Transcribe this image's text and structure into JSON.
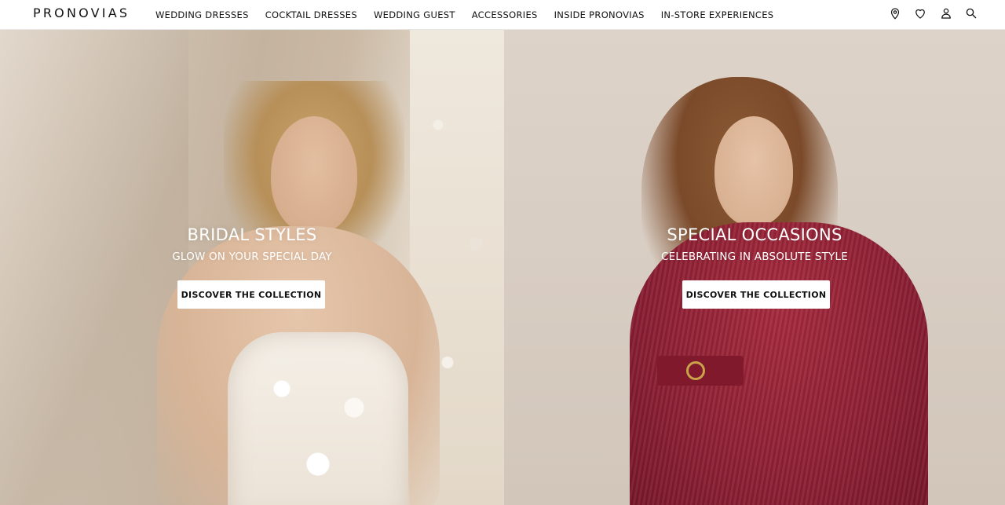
{
  "header": {
    "logo": "PRONOVIAS",
    "nav": [
      "WEDDING DRESSES",
      "COCKTAIL DRESSES",
      "WEDDING GUEST",
      "ACCESSORIES",
      "INSIDE PRONOVIAS",
      "IN-STORE EXPERIENCES"
    ],
    "icons": [
      "location-pin-icon",
      "heart-icon",
      "user-icon",
      "search-icon"
    ]
  },
  "hero": {
    "left": {
      "title": "BRIDAL STYLES",
      "subtitle": "GLOW ON YOUR SPECIAL DAY",
      "cta": "DISCOVER THE COLLECTION"
    },
    "right": {
      "title": "SPECIAL OCCASIONS",
      "subtitle": "CELEBRATING IN ABSOLUTE STYLE",
      "cta": "DISCOVER THE COLLECTION"
    }
  },
  "colors": {
    "header_bg": "#ffffff",
    "text_dark": "#111111",
    "burgundy": "#8d1f33"
  }
}
